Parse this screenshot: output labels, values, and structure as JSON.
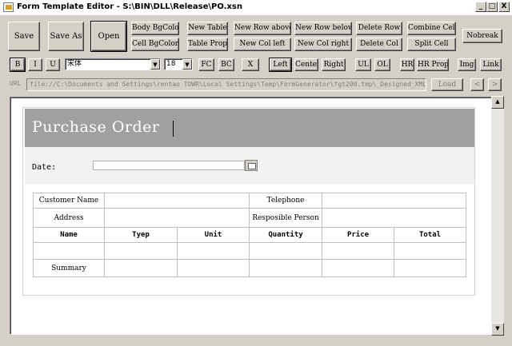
{
  "window": {
    "title": "Form Template Editor - S:\\BIN\\DLL\\Release\\PO.xsn",
    "controls": {
      "minimize": "_",
      "maximize": "□",
      "close": "X"
    }
  },
  "toolbar": {
    "save": "Save",
    "save_as": "Save As",
    "open": "Open",
    "body_bgcolor": "Body BgColor",
    "cell_bgcolor": "Cell BgColor",
    "new_table": "New Table",
    "table_prop": "Table Prop",
    "new_row_above": "New Row above",
    "new_col_left": "New Col left",
    "new_row_below": "New Row below",
    "new_col_right": "New Col right",
    "delete_row": "Delete Row",
    "delete_col": "Delete Col",
    "combine_cells": "Combine Cells",
    "split_cell": "Split Cell",
    "nobreak": "Nobreak"
  },
  "format": {
    "bold": "B",
    "italic": "I",
    "underline": "U",
    "font_value": "宋体",
    "size_value": "18",
    "fc": "FC",
    "bc": "BC",
    "x": "X",
    "left": "Left",
    "center": "Center",
    "right": "Right",
    "ul": "UL",
    "ol": "OL",
    "hr": "HR",
    "hr_prop": "HR Prop",
    "img": "Img",
    "link": "Link"
  },
  "url_bar": {
    "label": "URL",
    "value": "file://C:\\Documents and Settings\\rentao TOWR\\Local Settings\\Temp\\FormGenerator\\fgt200.tmp\\_Designed_XML",
    "load": "Load",
    "back": "<",
    "forward": ">"
  },
  "document": {
    "title": "Purchase Order",
    "date_label": "Date:",
    "table": {
      "info_rows": [
        [
          "Customer Name",
          "",
          "Telephone",
          ""
        ],
        [
          "Address",
          "",
          "Resposible Person",
          ""
        ]
      ],
      "headers": [
        "Name",
        "Tyep",
        "Unit",
        "Quantity",
        "Price",
        "Total"
      ],
      "summary_label": "Summary"
    }
  },
  "scrollbar": {
    "up": "▲",
    "down": "▼"
  }
}
